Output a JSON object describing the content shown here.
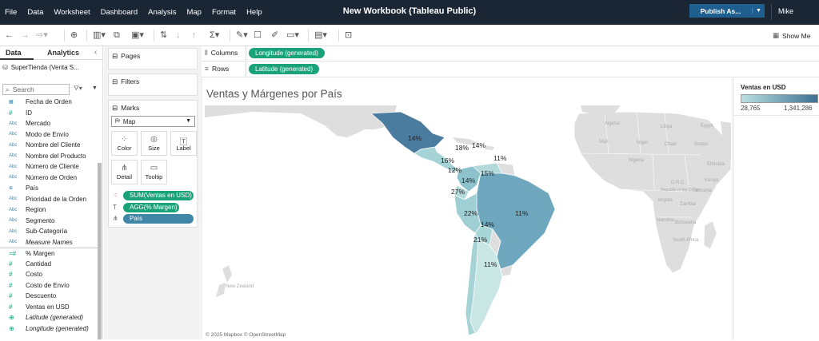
{
  "menubar": {
    "items": [
      "File",
      "Data",
      "Worksheet",
      "Dashboard",
      "Analysis",
      "Map",
      "Format",
      "Help"
    ],
    "title": "New Workbook (Tableau Public)",
    "publish_label": "Publish As...",
    "user": "Mike"
  },
  "toolbar": {
    "show_me_label": "Show Me",
    "icons": [
      "undo-icon",
      "redo-icon",
      "redo-dropdown-icon",
      "new-datasource-icon",
      "new-worksheet-icon",
      "duplicate-icon",
      "clear-icon",
      "swap-icon",
      "sort-ascending-icon",
      "sort-descending-icon",
      "sum-icon",
      "highlight-icon",
      "labels-icon",
      "annotate-icon",
      "fix-axes-icon",
      "fit-icon",
      "presentation-icon"
    ]
  },
  "left_panel": {
    "tab_data": "Data",
    "tab_analytics": "Analytics",
    "datasource": "SuperTienda (Venta S...",
    "search_placeholder": "Search",
    "fields": [
      {
        "name": "Fecha de Orden",
        "type": "date"
      },
      {
        "name": "ID",
        "type": "num"
      },
      {
        "name": "Mercado",
        "type": "abc"
      },
      {
        "name": "Modo de Envío",
        "type": "abc"
      },
      {
        "name": "Nombre del Cliente",
        "type": "abc"
      },
      {
        "name": "Nombre del Producto",
        "type": "abc"
      },
      {
        "name": "Número de Cliente",
        "type": "abc"
      },
      {
        "name": "Número de Orden",
        "type": "abc"
      },
      {
        "name": "País",
        "type": "geo"
      },
      {
        "name": "Prioridad de la Orden",
        "type": "abc"
      },
      {
        "name": "Region",
        "type": "abc"
      },
      {
        "name": "Segmento",
        "type": "abc"
      },
      {
        "name": "Sub-Categoría",
        "type": "abc"
      },
      {
        "name": "Measure Names",
        "type": "abc",
        "italic": true
      },
      {
        "name": "% Margen",
        "type": "calc",
        "sep": true
      },
      {
        "name": "Cantidad",
        "type": "num"
      },
      {
        "name": "Costo",
        "type": "num"
      },
      {
        "name": "Costo de Envío",
        "type": "num"
      },
      {
        "name": "Descuento",
        "type": "num"
      },
      {
        "name": "Ventas en USD",
        "type": "num"
      },
      {
        "name": "Latitude (generated)",
        "type": "geo",
        "italic": true
      },
      {
        "name": "Longitude (generated)",
        "type": "geo",
        "italic": true
      }
    ]
  },
  "cards": {
    "pages": "Pages",
    "filters": "Filters",
    "marks": "Marks",
    "mark_type": "Map",
    "buttons": [
      "Color",
      "Size",
      "Label",
      "Detail",
      "Tooltip"
    ],
    "pills": [
      "SUM(Ventas en USD)",
      "AGG(% Margen)",
      "País"
    ]
  },
  "shelves": {
    "columns_label": "Columns",
    "columns_pill": "Longitude (generated)",
    "rows_label": "Rows",
    "rows_pill": "Latitude (generated)"
  },
  "view": {
    "title": "Ventas y Márgenes por País",
    "copyright": "© 2025 Mapbox © OpenStreetMap",
    "country_labels": [
      "Algeria",
      "Libya",
      "Egypt",
      "Mali",
      "Niger",
      "Chad",
      "Sudan",
      "Nigeria",
      "Ethiopia",
      "Kenya",
      "D.R.C.",
      "Tanzania",
      "Angola",
      "Zambia",
      "Namibia",
      "Botswana",
      "Republic of the Congo",
      "South Africa",
      "New Zealand"
    ],
    "margin_labels": [
      "14%",
      "18%",
      "14%",
      "16%",
      "12%",
      "11%",
      "14%",
      "15%",
      "27%",
      "22%",
      "14%",
      "11%",
      "21%",
      "11%"
    ]
  },
  "legend": {
    "title": "Ventas en USD",
    "min": "28,765",
    "max": "1,341,286",
    "color_low": "#b9e0e1",
    "color_high": "#3d6f92"
  }
}
